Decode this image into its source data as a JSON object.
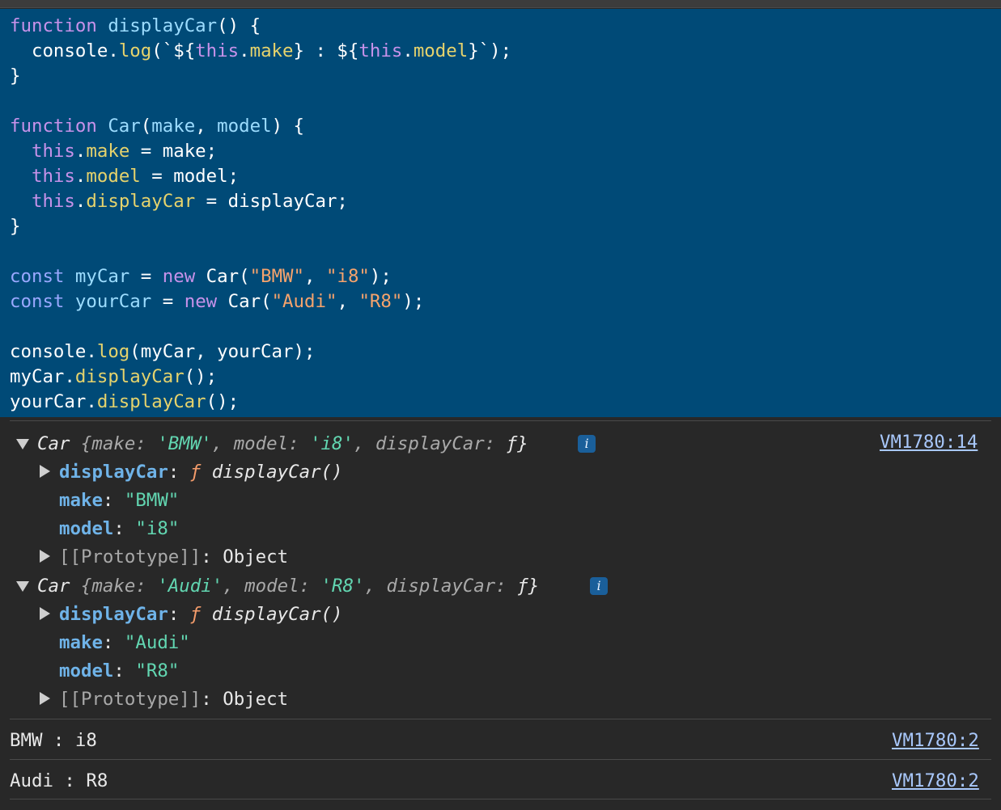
{
  "colors": {
    "editor_bg": "#004a77",
    "console_bg": "#282828",
    "link": "#a8c7fa"
  },
  "code": {
    "l1": {
      "a": "function",
      "b": " ",
      "c": "displayCar",
      "d": "() {"
    },
    "l2": {
      "a": "  console.",
      "b": "log",
      "c": "(`${",
      "d": "this",
      "e": ".",
      "f": "make",
      "g": "} : ${",
      "h": "this",
      "i": ".",
      "j": "model",
      "k": "}`);"
    },
    "l3": "}",
    "l5": {
      "a": "function",
      "b": " ",
      "c": "Car",
      "d": "(",
      "e": "make",
      "f": ", ",
      "g": "model",
      "h": ") {"
    },
    "l6": {
      "a": "  ",
      "b": "this",
      "c": ".",
      "d": "make",
      "e": " = make;"
    },
    "l7": {
      "a": "  ",
      "b": "this",
      "c": ".",
      "d": "model",
      "e": " = model;"
    },
    "l8": {
      "a": "  ",
      "b": "this",
      "c": ".",
      "d": "displayCar",
      "e": " = displayCar;"
    },
    "l9": "}",
    "l11": {
      "a": "const",
      "b": " ",
      "c": "myCar",
      "d": " = ",
      "e": "new",
      "f": " Car(",
      "g": "\"BMW\"",
      "h": ", ",
      "i": "\"i8\"",
      "j": ");"
    },
    "l12": {
      "a": "const",
      "b": " ",
      "c": "yourCar",
      "d": " = ",
      "e": "new",
      "f": " Car(",
      "g": "\"Audi\"",
      "h": ", ",
      "i": "\"R8\"",
      "j": ");"
    },
    "l14": {
      "a": "console.",
      "b": "log",
      "c": "(myCar, yourCar);"
    },
    "l15": {
      "a": "myCar.",
      "b": "displayCar",
      "c": "();"
    },
    "l16": {
      "a": "yourCar.",
      "b": "displayCar",
      "c": "();"
    }
  },
  "console": {
    "obj1": {
      "summary": {
        "cls": "Car",
        "open": " {",
        "k1": "make",
        "v1": "'BMW'",
        "k2": "model",
        "v2": "'i8'",
        "k3": "displayCar",
        "v3": "ƒ",
        "close": "}"
      },
      "info_badge": "i",
      "source": "VM1780:14",
      "p1": {
        "key": "displayCar",
        "f": "ƒ",
        "val": " displayCar()"
      },
      "p2": {
        "key": "make",
        "val": "\"BMW\""
      },
      "p3": {
        "key": "model",
        "val": "\"i8\""
      },
      "p4": {
        "key": "[[Prototype]]",
        "val": "Object"
      }
    },
    "obj2": {
      "summary": {
        "cls": "Car",
        "open": " {",
        "k1": "make",
        "v1": "'Audi'",
        "k2": "model",
        "v2": "'R8'",
        "k3": "displayCar",
        "v3": "ƒ",
        "close": "}"
      },
      "info_badge": "i",
      "p1": {
        "key": "displayCar",
        "f": "ƒ",
        "val": " displayCar()"
      },
      "p2": {
        "key": "make",
        "val": "\"Audi\""
      },
      "p3": {
        "key": "model",
        "val": "\"R8\""
      },
      "p4": {
        "key": "[[Prototype]]",
        "val": "Object"
      }
    },
    "out1": {
      "text": "BMW : i8",
      "source": "VM1780:2"
    },
    "out2": {
      "text": "Audi : R8",
      "source": "VM1780:2"
    }
  }
}
